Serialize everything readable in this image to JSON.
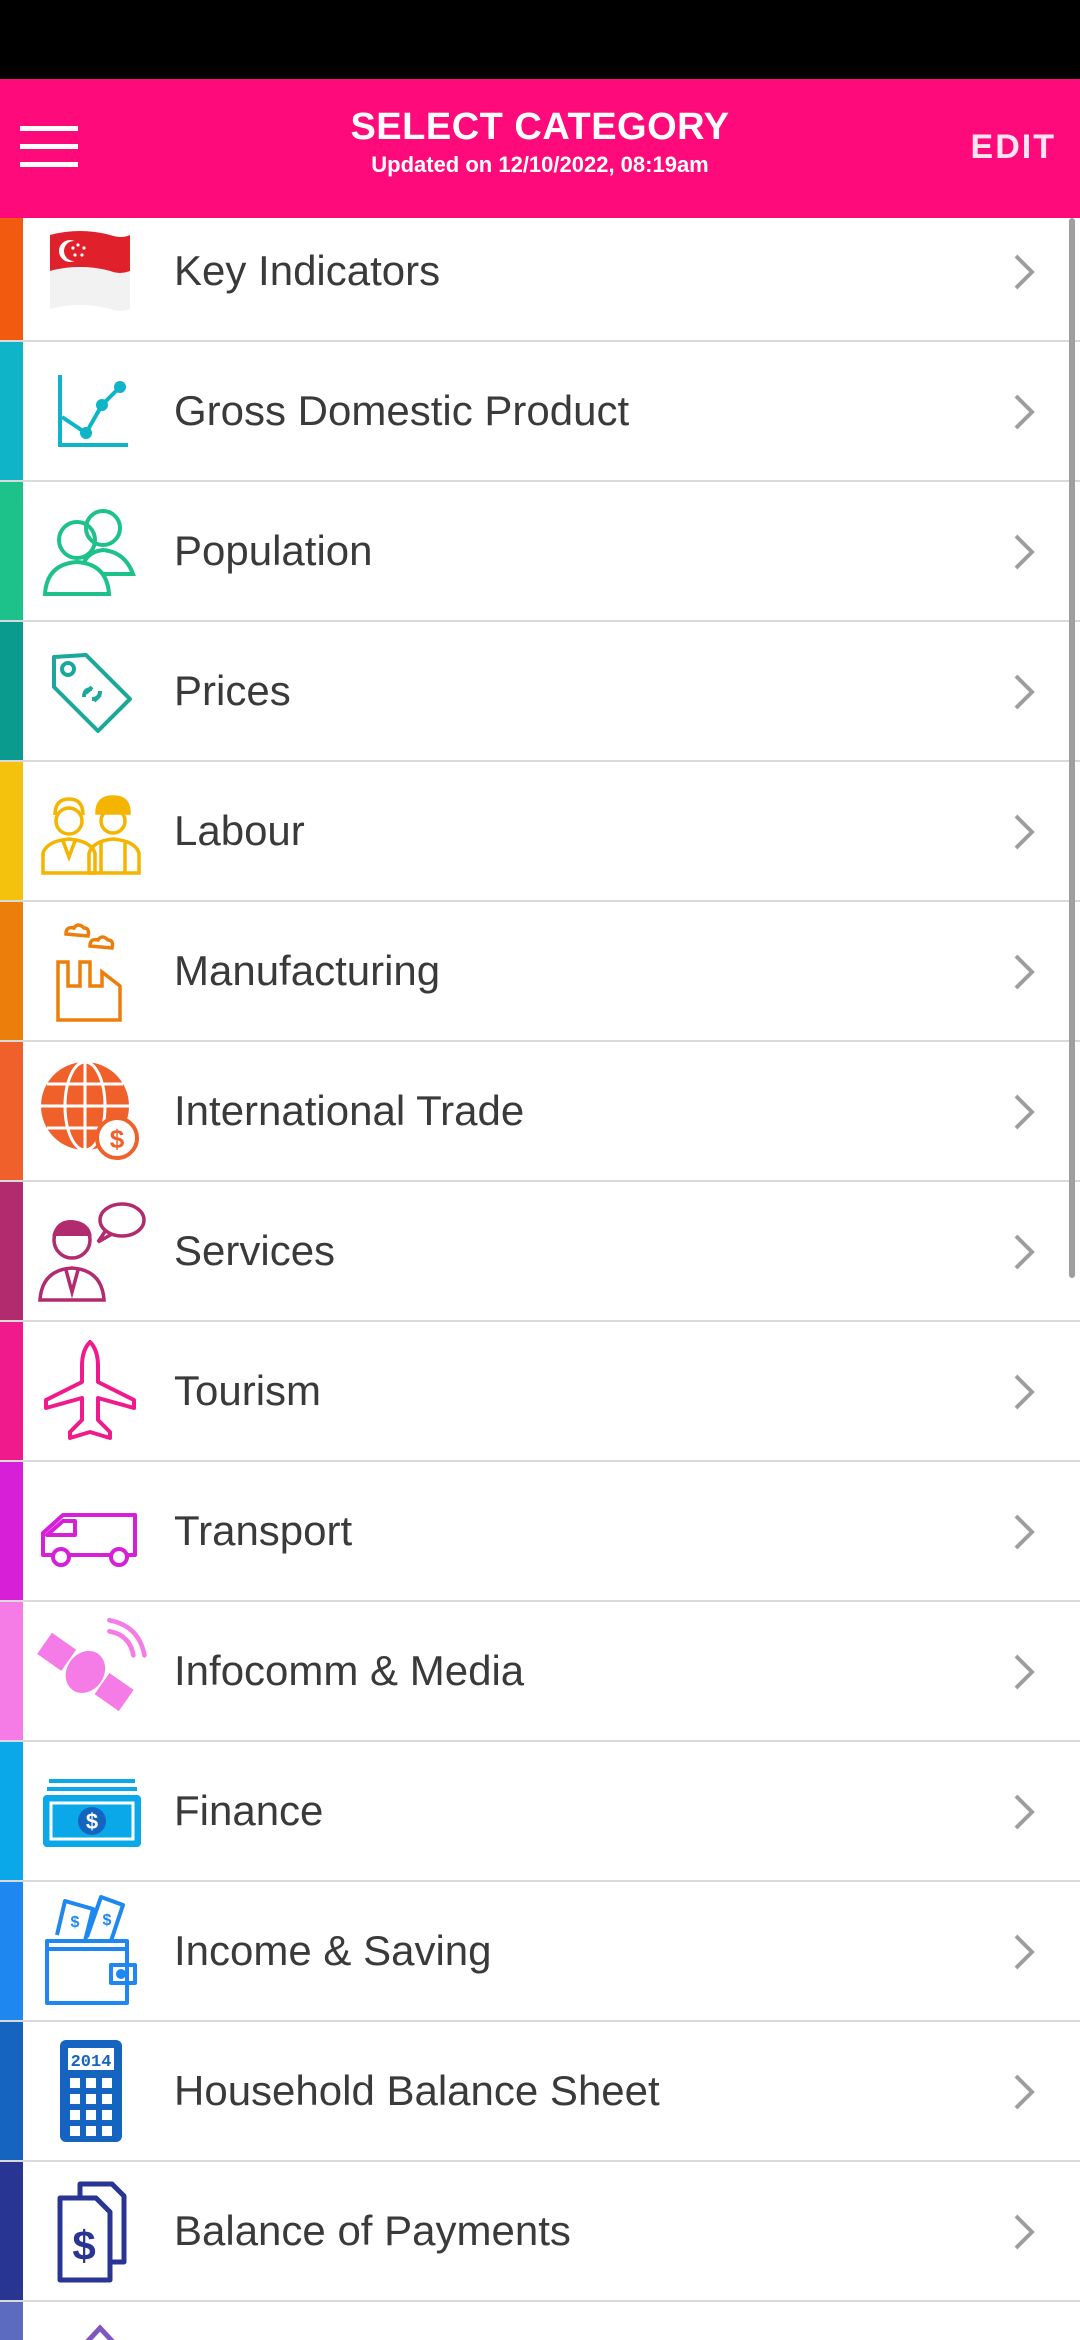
{
  "header": {
    "title": "SELECT CATEGORY",
    "subtitle": "Updated on 12/10/2022, 08:19am",
    "edit_label": "EDIT",
    "background": "#ff0a7a"
  },
  "categories": [
    {
      "label": "Key Indicators",
      "icon": "singapore-flag-icon",
      "color": "#f25a0f"
    },
    {
      "label": "Gross Domestic Product",
      "icon": "line-chart-icon",
      "color": "#0fb4c8"
    },
    {
      "label": "Population",
      "icon": "people-icon",
      "color": "#1cc28a"
    },
    {
      "label": "Prices",
      "icon": "price-tag-icon",
      "color": "#0a9b8e"
    },
    {
      "label": "Labour",
      "icon": "workers-icon",
      "color": "#f4c20d"
    },
    {
      "label": "Manufacturing",
      "icon": "factory-icon",
      "color": "#ec7f0c"
    },
    {
      "label": "International Trade",
      "icon": "globe-dollar-icon",
      "color": "#f0602a"
    },
    {
      "label": "Services",
      "icon": "service-person-icon",
      "color": "#b22b6e"
    },
    {
      "label": "Tourism",
      "icon": "airplane-icon",
      "color": "#f01a8c"
    },
    {
      "label": "Transport",
      "icon": "van-icon",
      "color": "#d81fd8"
    },
    {
      "label": "Infocomm & Media",
      "icon": "satellite-icon",
      "color": "#f57ce6"
    },
    {
      "label": "Finance",
      "icon": "banknote-icon",
      "color": "#0aa8e8"
    },
    {
      "label": "Income & Saving",
      "icon": "wallet-icon",
      "color": "#1e88f0"
    },
    {
      "label": "Household Balance Sheet",
      "icon": "calculator-icon",
      "color": "#1565c0"
    },
    {
      "label": "Balance of Payments",
      "icon": "documents-dollar-icon",
      "color": "#283593"
    },
    {
      "label": "",
      "icon": "diamond-icon",
      "color": "#5c6bc0"
    }
  ],
  "calculator_display": "2014"
}
